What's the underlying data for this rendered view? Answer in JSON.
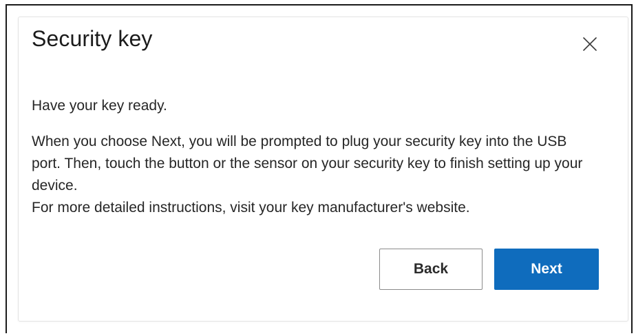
{
  "dialog": {
    "title": "Security key",
    "close_icon": "close-icon",
    "paragraphs": [
      "Have your key ready.",
      "When you choose Next, you will be prompted to plug your security key into the USB port. Then, touch the button or the sensor on your security key to finish setting up your device.",
      "For more detailed instructions, visit your key manufacturer's website."
    ],
    "buttons": {
      "back_label": "Back",
      "next_label": "Next"
    }
  },
  "colors": {
    "primary": "#0f6cbd",
    "text": "#262626",
    "border": "#8a8a8a"
  }
}
